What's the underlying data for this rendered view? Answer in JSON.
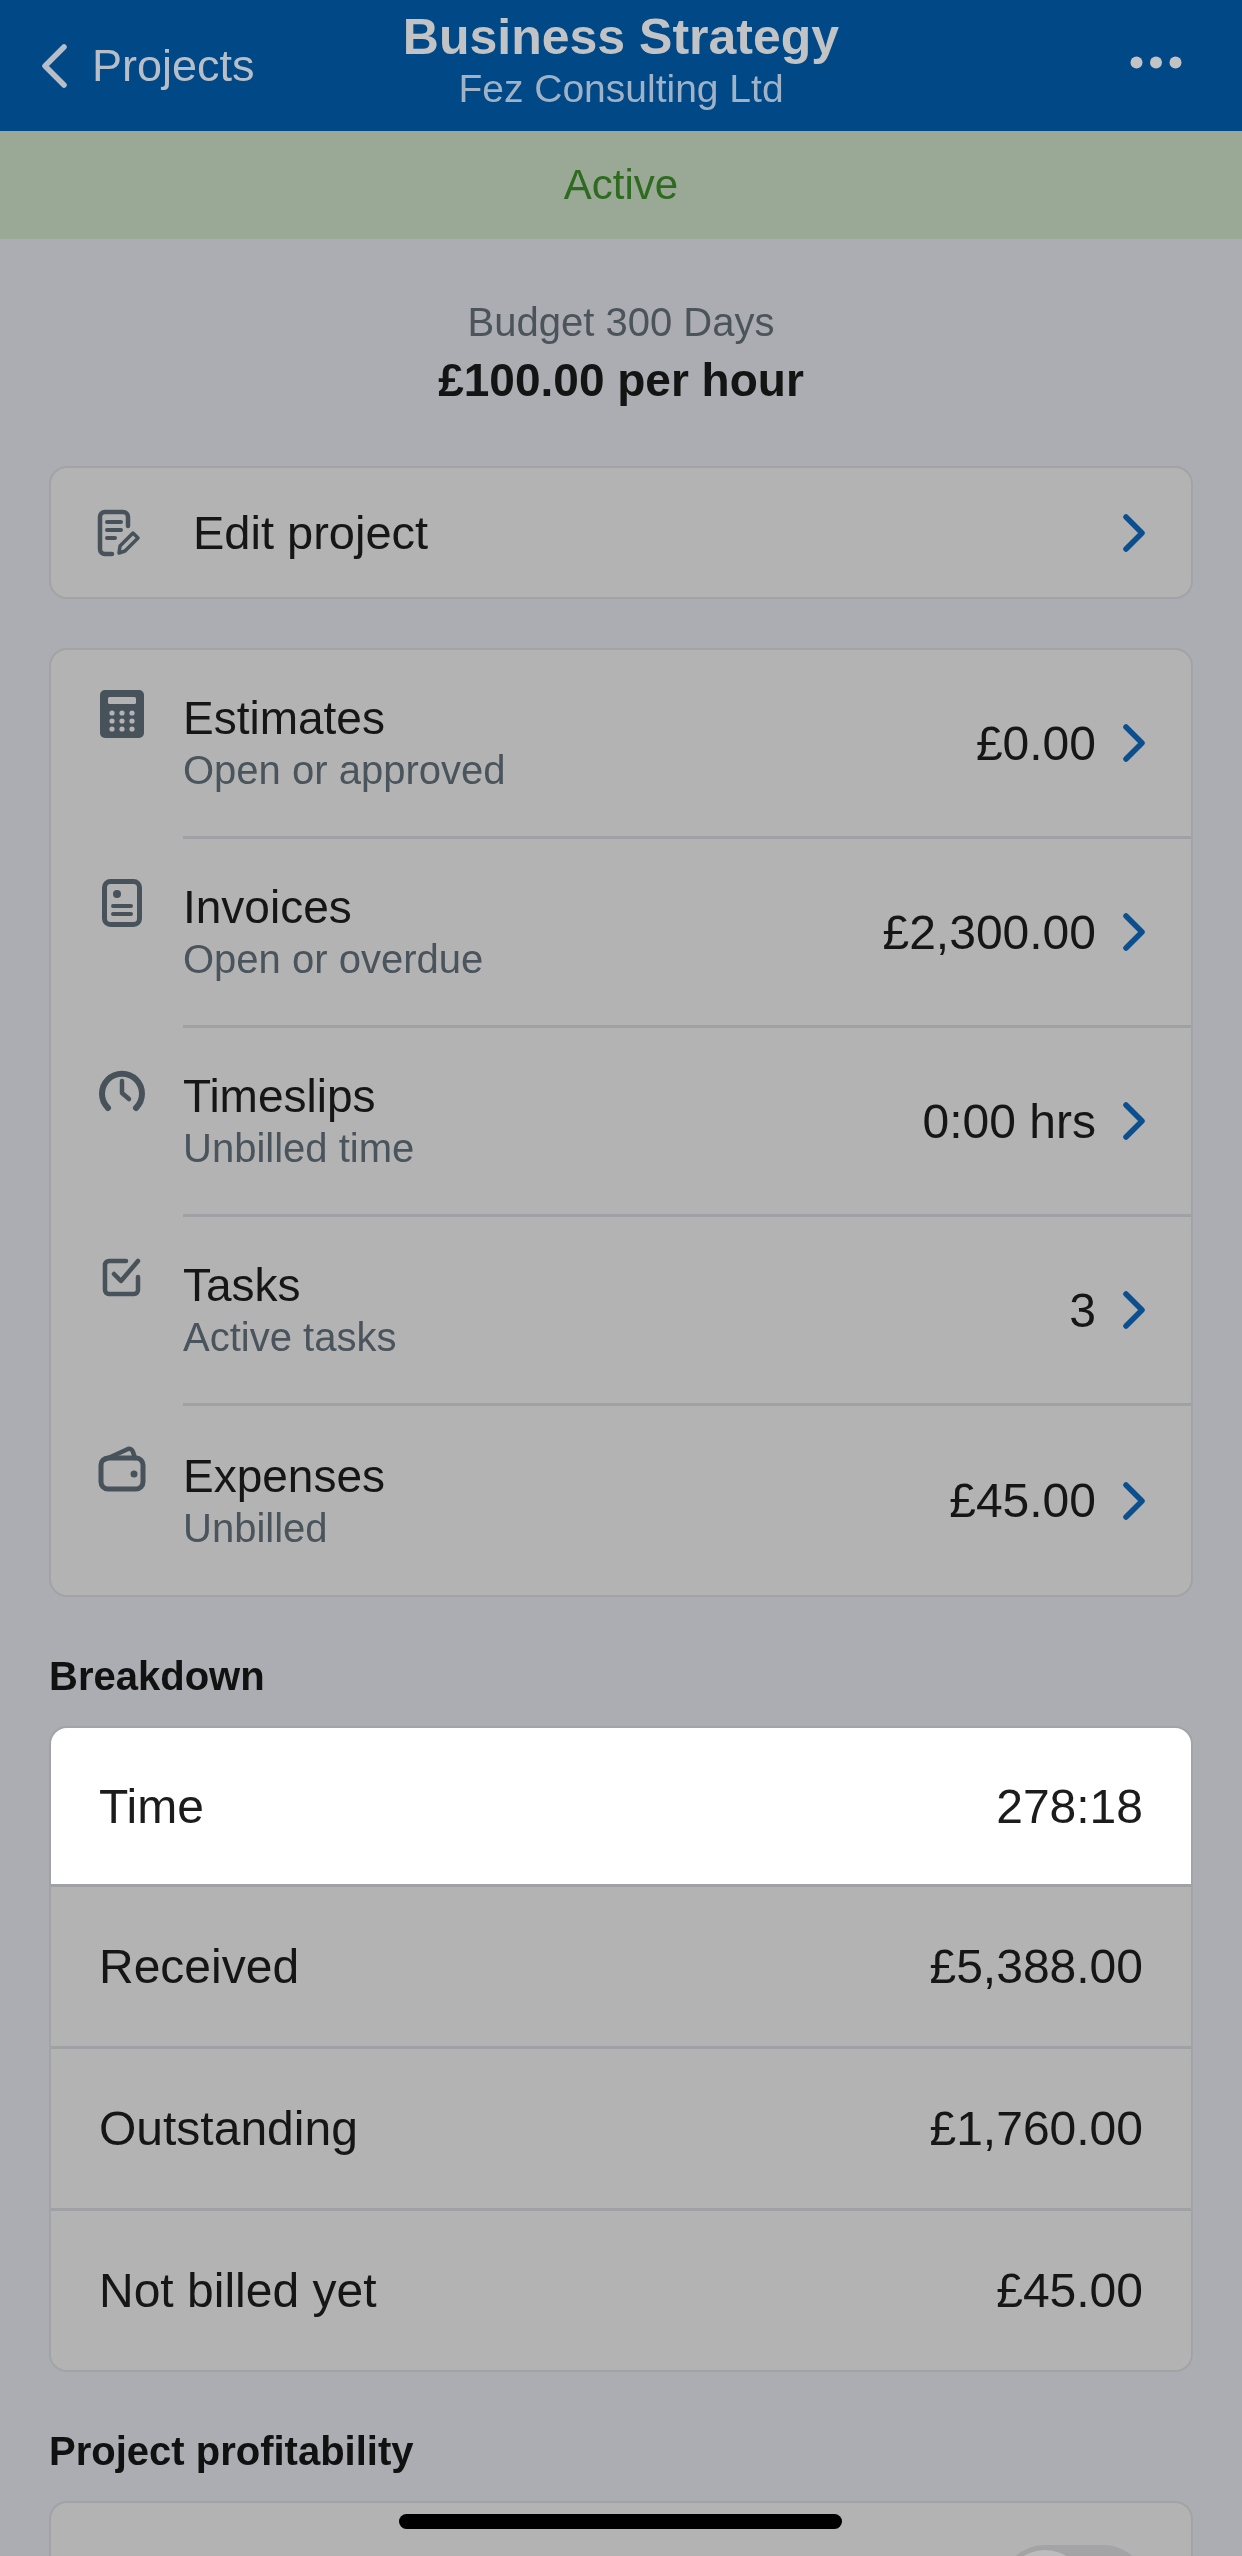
{
  "nav": {
    "back_label": "Projects",
    "title": "Business Strategy",
    "subtitle": "Fez Consulting Ltd"
  },
  "status_banner": {
    "label": "Active"
  },
  "budget": {
    "label": "Budget 300 Days",
    "rate": "£100.00 per hour"
  },
  "edit_action": {
    "label": "Edit project"
  },
  "summary_items": [
    {
      "kind": "estimates",
      "title": "Estimates",
      "subtitle": "Open or approved",
      "value": "£0.00"
    },
    {
      "kind": "invoices",
      "title": "Invoices",
      "subtitle": "Open or overdue",
      "value": "£2,300.00"
    },
    {
      "kind": "timeslips",
      "title": "Timeslips",
      "subtitle": "Unbilled time",
      "value": "0:00 hrs"
    },
    {
      "kind": "tasks",
      "title": "Tasks",
      "subtitle": "Active tasks",
      "value": "3"
    },
    {
      "kind": "expenses",
      "title": "Expenses",
      "subtitle": "Unbilled",
      "value": "£45.00"
    }
  ],
  "breakdown": {
    "heading": "Breakdown",
    "rows": [
      {
        "label": "Time",
        "value": "278:18",
        "highlighted": true
      },
      {
        "label": "Received",
        "value": "£5,388.00",
        "highlighted": false
      },
      {
        "label": "Outstanding",
        "value": "£1,760.00",
        "highlighted": false
      },
      {
        "label": "Not billed yet",
        "value": "£45.00",
        "highlighted": false
      }
    ]
  },
  "profitability": {
    "heading": "Project profitability",
    "toggle": {
      "on": false
    }
  }
}
